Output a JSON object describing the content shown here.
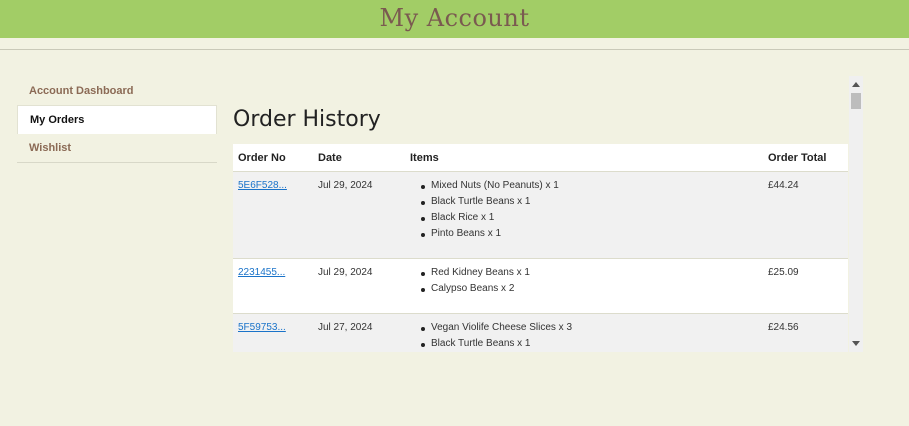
{
  "header": {
    "title": "My Account"
  },
  "sidebar": {
    "items": [
      {
        "label": "Account Dashboard"
      },
      {
        "label": "My Orders"
      },
      {
        "label": "Wishlist"
      }
    ]
  },
  "main": {
    "heading": "Order History",
    "columns": [
      "Order No",
      "Date",
      "Items",
      "Order Total"
    ],
    "orders": [
      {
        "no": "5E6F528...",
        "date": "Jul 29, 2024",
        "items": [
          "Mixed Nuts (No Peanuts) x 1",
          "Black Turtle Beans x 1",
          "Black Rice x 1",
          "Pinto Beans x 1"
        ],
        "total": "£44.24"
      },
      {
        "no": "2231455...",
        "date": "Jul 29, 2024",
        "items": [
          "Red Kidney Beans x 1",
          "Calypso Beans x 2"
        ],
        "total": "£25.09"
      },
      {
        "no": "5F59753...",
        "date": "Jul 27, 2024",
        "items": [
          "Vegan Violife Cheese Slices x 3",
          "Black Turtle Beans x 1"
        ],
        "total": "£24.56"
      }
    ]
  }
}
